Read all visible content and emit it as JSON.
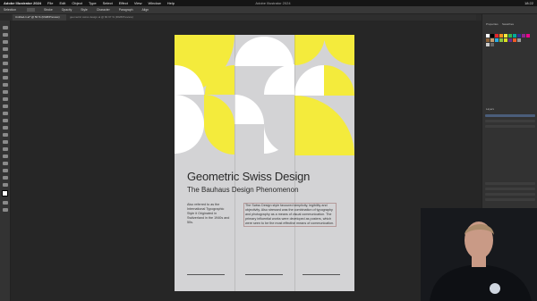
{
  "menubar": {
    "app": "Adobe Illustrator 2024",
    "items": [
      "File",
      "Edit",
      "Object",
      "Type",
      "Select",
      "Effect",
      "View",
      "Window",
      "Help"
    ],
    "clock": "18:22"
  },
  "window": {
    "title": "Adobe Illustrator 2024"
  },
  "control_bar": {
    "selection_label": "Selection",
    "stroke_label": "Stroke",
    "opacity_label": "Opacity",
    "style_label": "Style",
    "character_label": "Character",
    "paragraph_label": "Paragraph",
    "align_label": "Align"
  },
  "tabs": [
    {
      "label": "Untitled-1.ai* @ 50 % (RGB/Preview)",
      "active": true
    },
    {
      "label": "geometric swiss design.ai @ 66.67 % (RGB/Preview)",
      "active": false
    }
  ],
  "poster": {
    "title": "Geometric Swiss Design",
    "subtitle": "The Bauhaus Design Phenomenon",
    "col1": "Also referred to as the International Typographic Style it Originated in Switzerland in the 1940s and 50s.",
    "col2": "The Swiss Design style favoured simplicity, legibility and objectivity. Also stressed was the combination of typography and photography as a means of visual communication. The primary influential works were developed as posters, which were seen to be the most effective means of communication.",
    "colors": {
      "yellow": "#f4eb3c",
      "grey": "#d3d3d5",
      "white": "#ffffff",
      "text": "#2a2a2a"
    }
  },
  "right_panels": {
    "tab_swatches": "Swatches",
    "tab_layers": "Layers",
    "tab_properties": "Properties"
  },
  "icons": [
    "selection-tool-icon",
    "direct-selection-icon",
    "pen-tool-icon",
    "type-tool-icon",
    "rectangle-tool-icon",
    "zoom-icon",
    "hand-icon"
  ]
}
